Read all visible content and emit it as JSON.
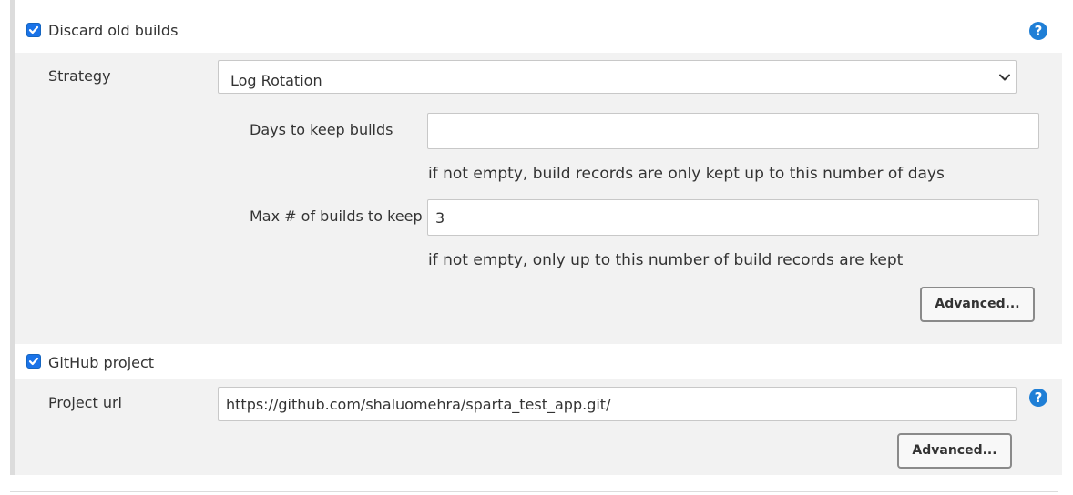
{
  "discard": {
    "checkbox_label": "Discard old builds",
    "checked": true,
    "strategy_label": "Strategy",
    "strategy_value": "Log Rotation",
    "days_label": "Days to keep builds",
    "days_value": "",
    "days_hint": "if not empty, build records are only kept up to this number of days",
    "max_label": "Max # of builds to keep",
    "max_value": "3",
    "max_hint": "if not empty, only up to this number of build records are kept",
    "advanced_label": "Advanced..."
  },
  "github": {
    "checkbox_label": "GitHub project",
    "checked": true,
    "url_label": "Project url",
    "url_value": "https://github.com/shaluomehra/sparta_test_app.git/",
    "advanced_label": "Advanced..."
  },
  "help_symbol": "?",
  "colors": {
    "accent": "#1f7fd6",
    "panel": "#f2f2f2",
    "border": "#c8c8c8"
  }
}
